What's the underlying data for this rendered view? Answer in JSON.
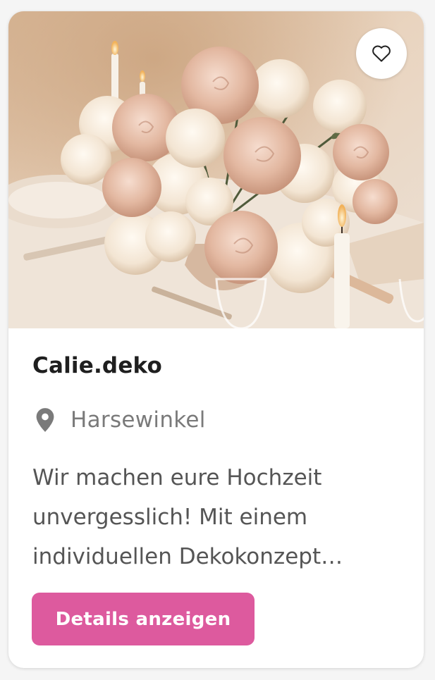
{
  "card": {
    "image_alt": "floral-centerpiece-photo",
    "favorite_icon": "heart-outline-icon",
    "title": "Calie.deko",
    "location_icon": "map-pin-icon",
    "location": "Harsewinkel",
    "description": "Wir machen eure Hochzeit unvergesslich! Mit einem individuellen Dekokonzept…",
    "button_label": "Details anzeigen"
  },
  "colors": {
    "accent": "#dd5a9e",
    "title": "#1f1f1f",
    "muted": "#7a7a7a",
    "body_text": "#555555"
  }
}
